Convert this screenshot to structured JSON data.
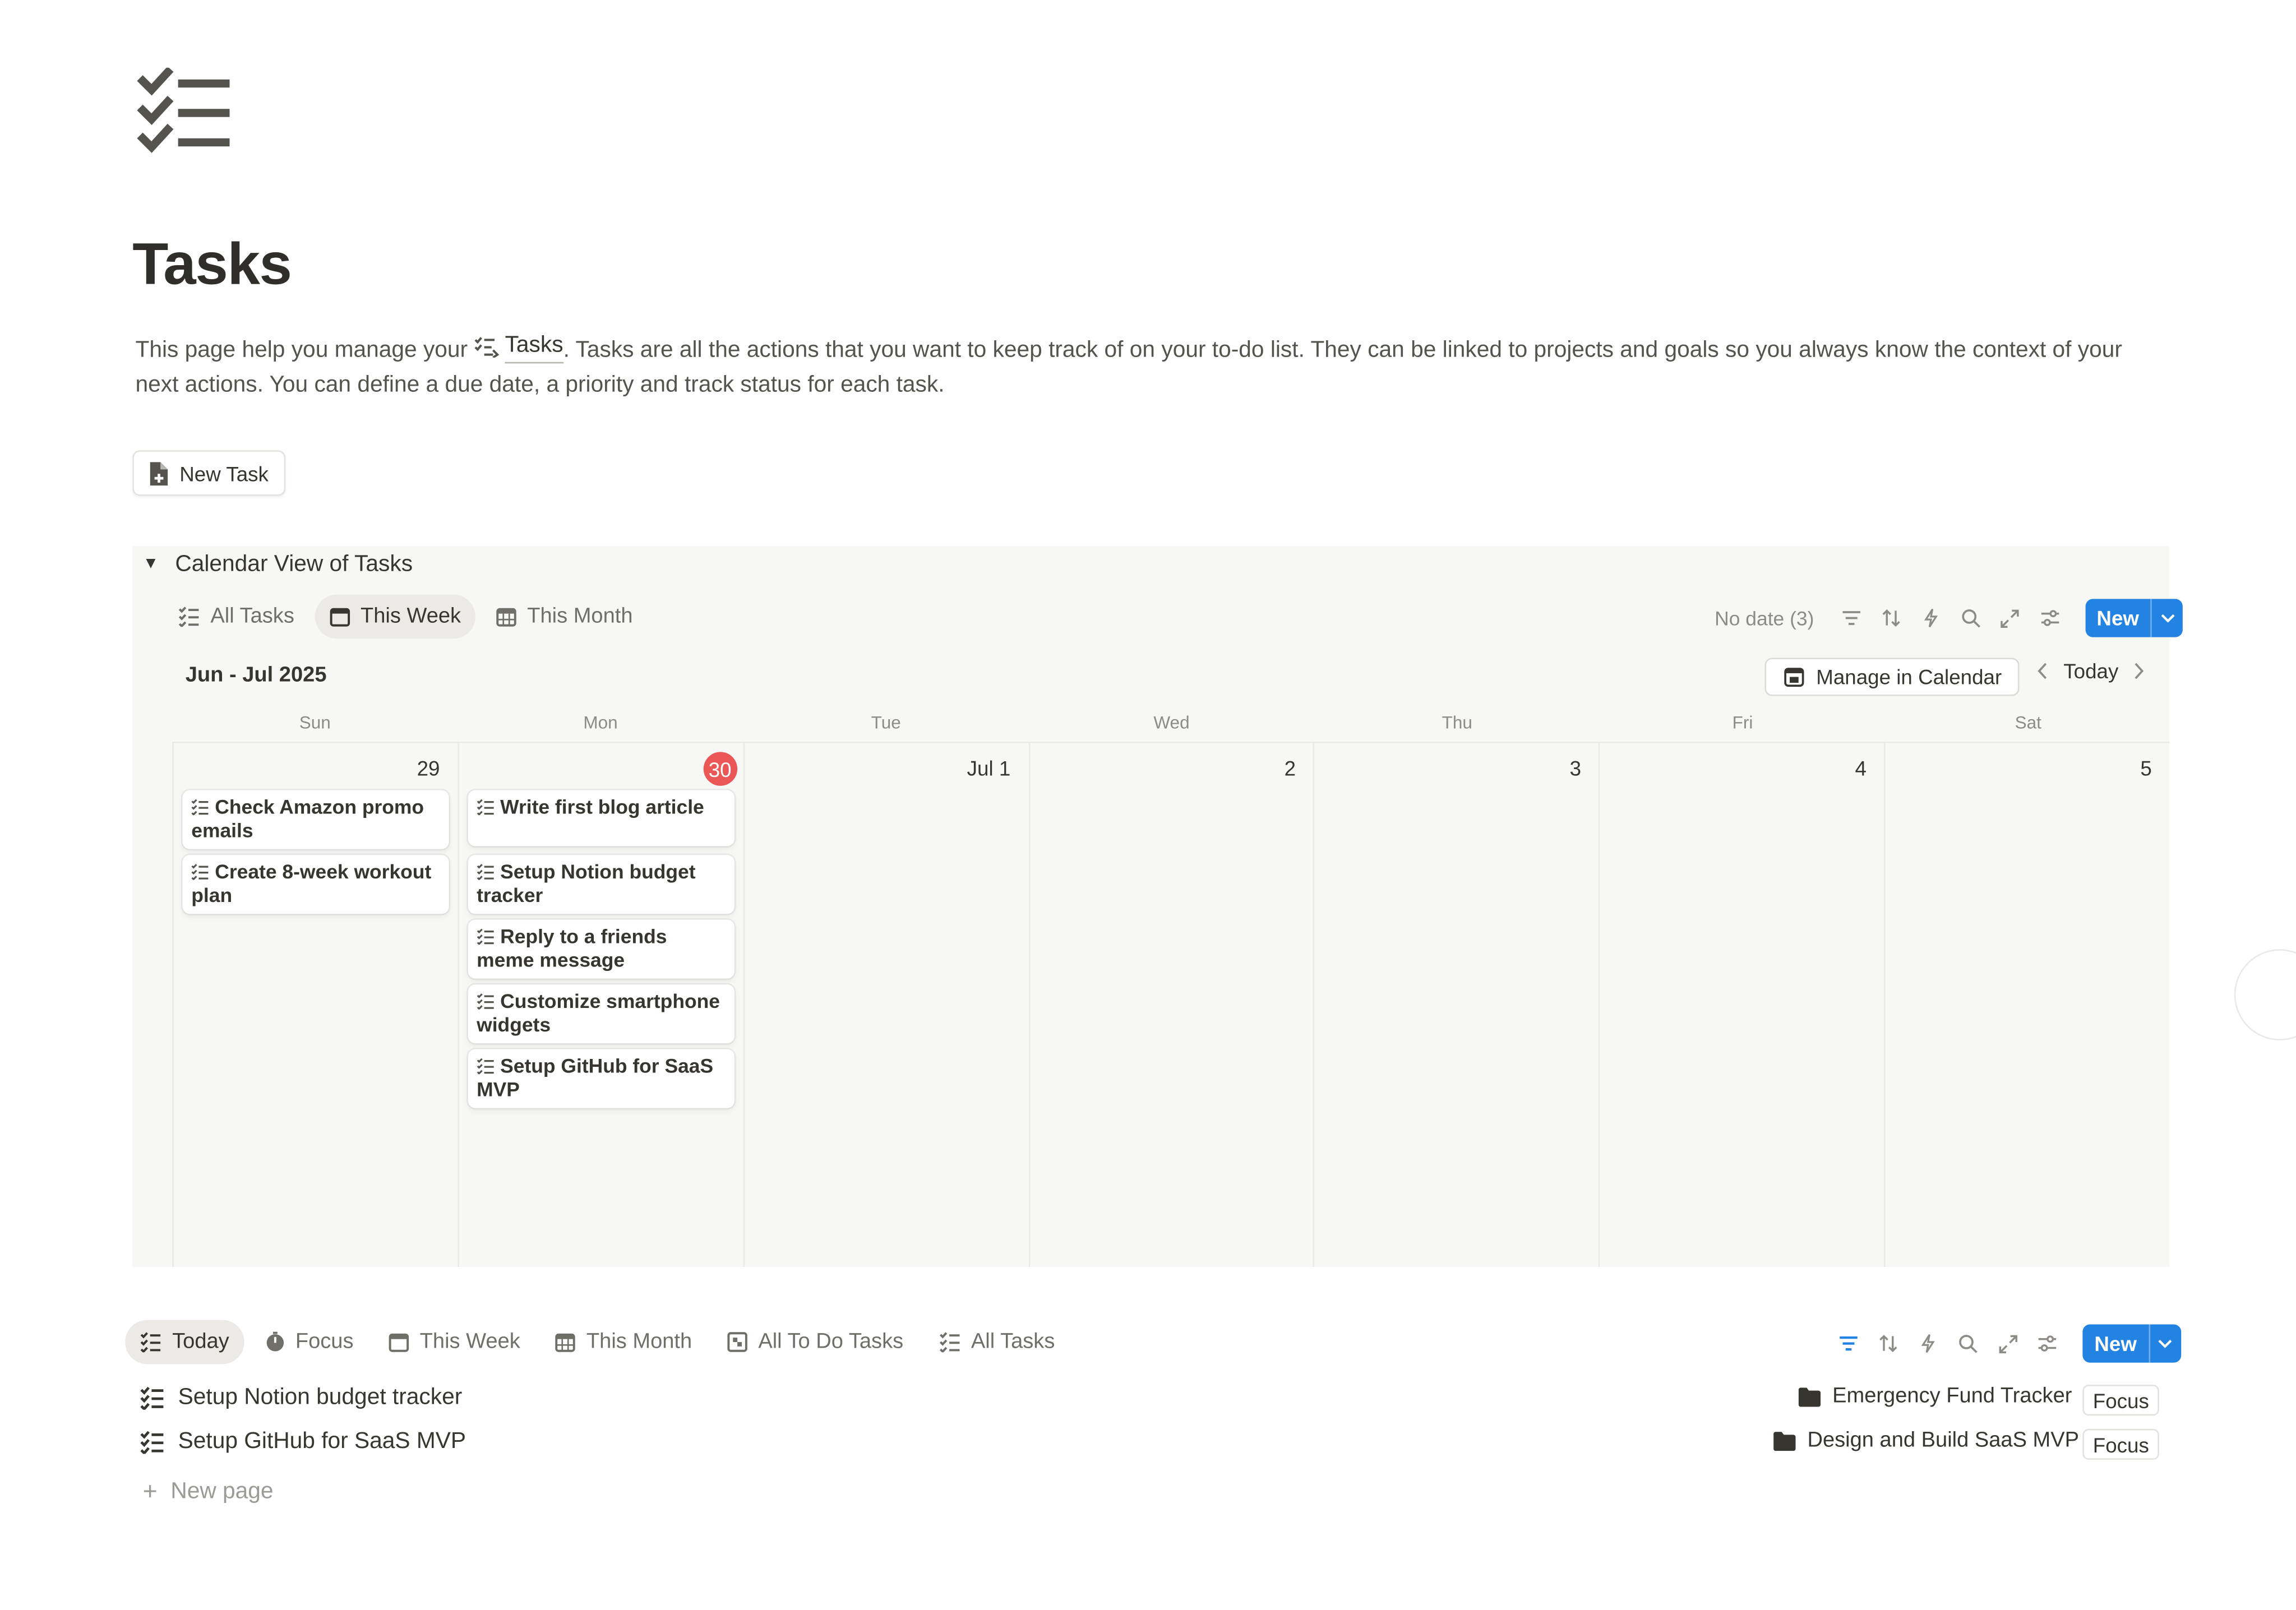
{
  "page": {
    "icon": "checklist-icon",
    "title": "Tasks",
    "description_prefix": "This page help you manage your",
    "description_mention": "Tasks",
    "description_suffix": ". Tasks are all the actions that you want to keep track of on your to-do list. They can be linked to projects and goals so you always know the context of your next actions. You can define a due date, a priority and track status for each task."
  },
  "new_task_button": {
    "label": "New Task",
    "icon": "document-plus-icon"
  },
  "calendar_section": {
    "heading": "Calendar View of Tasks",
    "tabs": [
      {
        "label": "All Tasks",
        "icon": "checklist-icon",
        "active": false
      },
      {
        "label": "This Week",
        "icon": "calendar-icon",
        "active": true
      },
      {
        "label": "This Month",
        "icon": "calendar-grid-icon",
        "active": false
      }
    ],
    "no_date_label": "No date (3)",
    "new_button": "New",
    "range_label": "Jun - Jul 2025",
    "manage_button": "Manage in Calendar",
    "today_button": "Today",
    "weekdays": [
      "Sun",
      "Mon",
      "Tue",
      "Wed",
      "Thu",
      "Fri",
      "Sat"
    ],
    "days": [
      {
        "label": "29",
        "today": false,
        "tasks": [
          "Check Amazon promo emails",
          "Create 8-week workout plan"
        ]
      },
      {
        "label": "30",
        "today": true,
        "tasks": [
          "Write first blog article",
          "Setup Notion budget tracker",
          "Reply to a friends meme message",
          "Customize smartphone widgets",
          "Setup GitHub for SaaS MVP"
        ]
      },
      {
        "label": "Jul 1",
        "today": false,
        "tasks": []
      },
      {
        "label": "2",
        "today": false,
        "tasks": []
      },
      {
        "label": "3",
        "today": false,
        "tasks": []
      },
      {
        "label": "4",
        "today": false,
        "tasks": []
      },
      {
        "label": "5",
        "today": false,
        "tasks": []
      }
    ]
  },
  "list_section": {
    "tabs": [
      {
        "label": "Today",
        "icon": "checklist-icon",
        "active": true
      },
      {
        "label": "Focus",
        "icon": "timer-icon",
        "active": false
      },
      {
        "label": "This Week",
        "icon": "calendar-icon",
        "active": false
      },
      {
        "label": "This Month",
        "icon": "calendar-grid-icon",
        "active": false
      },
      {
        "label": "All To Do Tasks",
        "icon": "flag-board-icon",
        "active": false
      },
      {
        "label": "All Tasks",
        "icon": "checklist-icon",
        "active": false
      }
    ],
    "new_button": "New",
    "rows": [
      {
        "title": "Setup Notion budget tracker",
        "project": "Emergency Fund Tracker",
        "tag": "Focus"
      },
      {
        "title": "Setup GitHub for SaaS MVP",
        "project": "Design and Build SaaS MVP",
        "tag": "Focus"
      }
    ],
    "new_page_label": "New page"
  },
  "colors": {
    "accent": "#2383e2",
    "today": "#eb5757",
    "text": "#37352f",
    "muted": "#8d8b86",
    "panel": "#f7f7f5"
  }
}
